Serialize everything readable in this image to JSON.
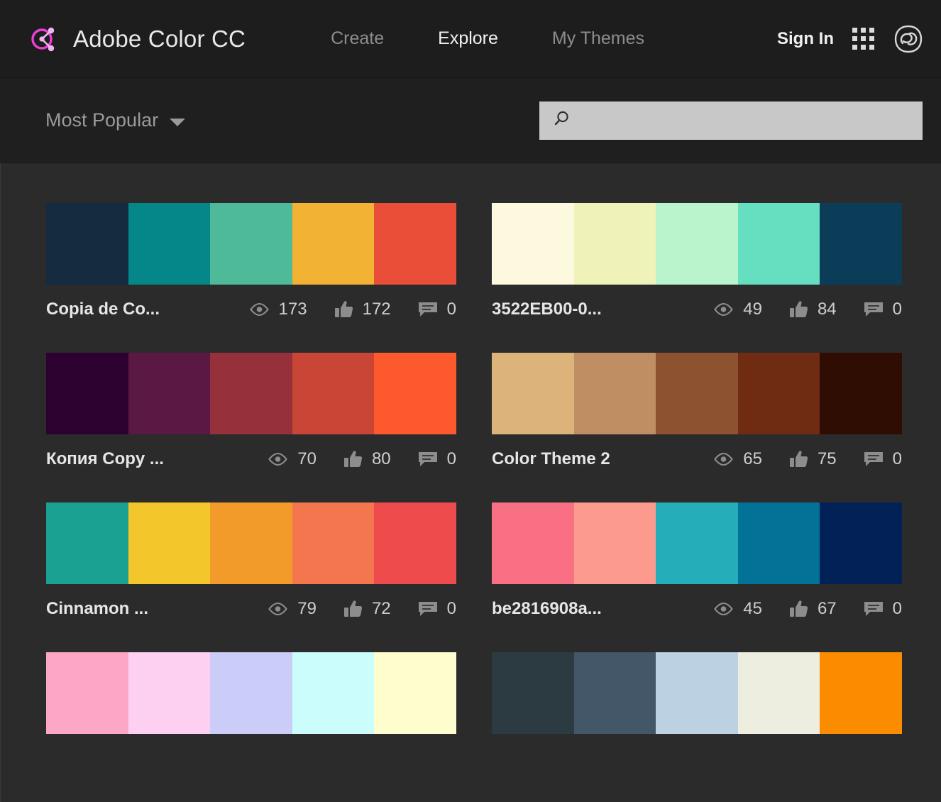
{
  "header": {
    "brand_title": "Adobe Color CC",
    "logo_color": "#EC3FD8",
    "nav": [
      {
        "label": "Create",
        "active": false
      },
      {
        "label": "Explore",
        "active": true
      },
      {
        "label": "My Themes",
        "active": false
      }
    ],
    "sign_in_label": "Sign In",
    "apps_icon": "grid-apps-icon",
    "cc_icon": "creative-cloud-icon"
  },
  "filter_bar": {
    "sort_label": "Most Popular",
    "sort_caret_icon": "chevron-down-icon",
    "search": {
      "icon": "search-icon",
      "value": "",
      "placeholder": ""
    }
  },
  "themes": [
    {
      "name": "Copia de Co...",
      "swatches": [
        "#152B3F",
        "#058789",
        "#4FBA9A",
        "#F2B233",
        "#EA4D38"
      ],
      "views": "173",
      "likes": "172",
      "comments": "0"
    },
    {
      "name": "3522EB00-0...",
      "swatches": [
        "#FCF9DF",
        "#EFF2B9",
        "#B9F4CD",
        "#66DFC1",
        "#0B3D58"
      ],
      "views": "49",
      "likes": "84",
      "comments": "0"
    },
    {
      "name": "Копия Copy ...",
      "swatches": [
        "#2E0230",
        "#5B1844",
        "#96303B",
        "#C94637",
        "#FC5A2D"
      ],
      "views": "70",
      "likes": "80",
      "comments": "0"
    },
    {
      "name": "Color Theme 2",
      "swatches": [
        "#DCB37A",
        "#BF8E63",
        "#8D5331",
        "#6F2C13",
        "#2F0D03"
      ],
      "views": "65",
      "likes": "75",
      "comments": "0"
    },
    {
      "name": "Cinnamon ...",
      "swatches": [
        "#1BA191",
        "#F3C72B",
        "#F29B2B",
        "#F4764E",
        "#EE4C4C"
      ],
      "views": "79",
      "likes": "72",
      "comments": "0"
    },
    {
      "name": "be2816908a...",
      "swatches": [
        "#F97084",
        "#FC9A8D",
        "#26ADBA",
        "#027296",
        "#022257"
      ],
      "views": "45",
      "likes": "67",
      "comments": "0"
    },
    {
      "name": "",
      "swatches": [
        "#FCA7C6",
        "#FDD0F2",
        "#CCCCF9",
        "#CCFDFD",
        "#FDFDCD"
      ],
      "views": "",
      "likes": "",
      "comments": ""
    },
    {
      "name": "",
      "swatches": [
        "#2C3A42",
        "#435769",
        "#BCD1E1",
        "#EDEEDF",
        "#FB8C00"
      ],
      "views": "",
      "likes": "",
      "comments": ""
    }
  ],
  "stat_icons": {
    "views": "eye-icon",
    "likes": "thumbs-up-icon",
    "comments": "comment-icon"
  }
}
